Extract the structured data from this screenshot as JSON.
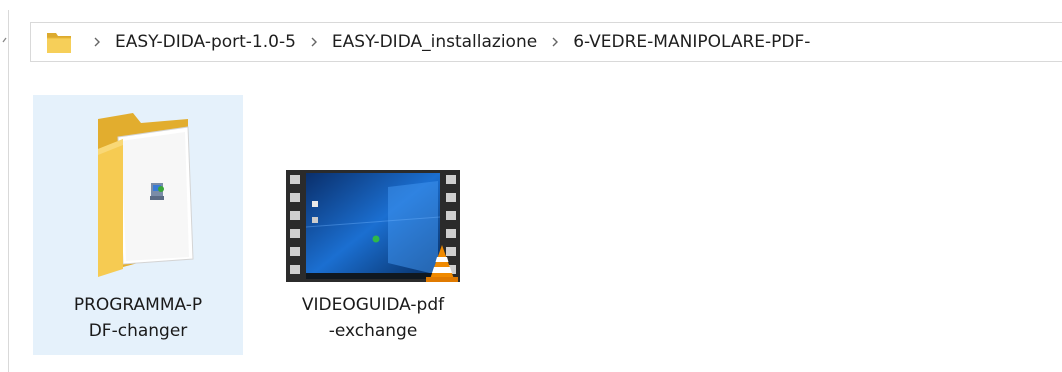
{
  "breadcrumb": {
    "items": [
      {
        "label": "EASY-DIDA-port-1.0-5"
      },
      {
        "label": "EASY-DIDA_installazione"
      },
      {
        "label": "6-VEDRE-MANIPOLARE-PDF-"
      }
    ]
  },
  "files": [
    {
      "name_line1": "PROGRAMMA-P",
      "name_line2": "DF-changer",
      "type": "folder",
      "selected": true
    },
    {
      "name_line1": "VIDEOGUIDA-pdf",
      "name_line2": "-exchange",
      "type": "video",
      "selected": false
    }
  ],
  "colors": {
    "selection": "#e5f1fb",
    "folder": "#f3c94b",
    "vlc": "#f08a00"
  }
}
